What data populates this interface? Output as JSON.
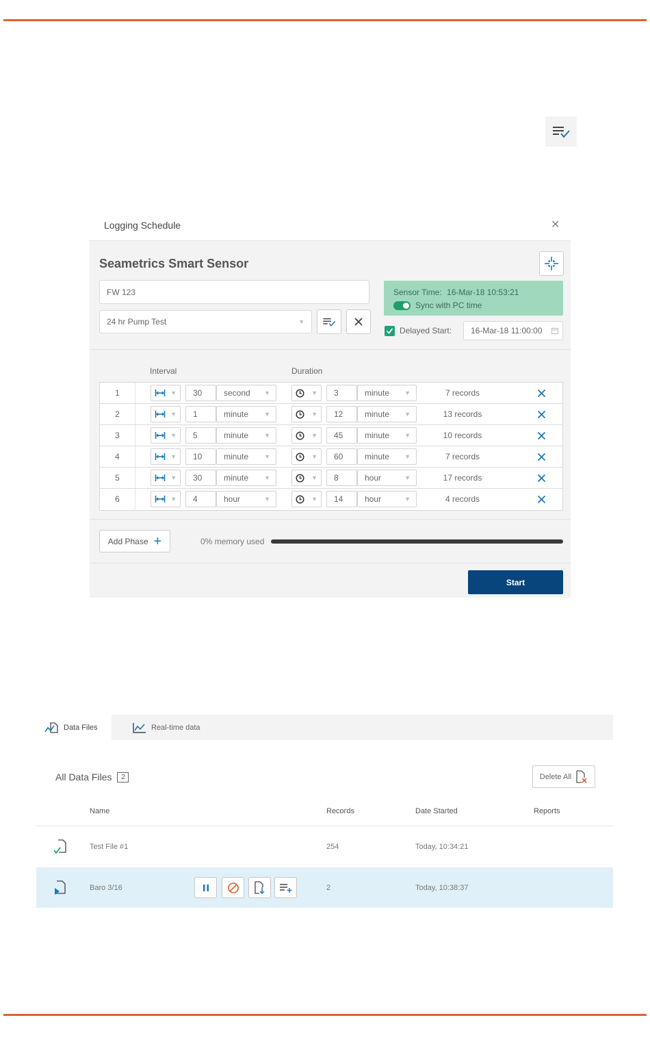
{
  "dialog": {
    "title": "Logging Schedule",
    "sensor_name": "Seametrics Smart Sensor",
    "name_input_value": "FW 123",
    "schedule_value": "24 hr Pump Test",
    "sensor_time_label": "Sensor Time:",
    "sensor_time_value": "16-Mar-18 10:53:21",
    "sync_label": "Sync with PC time",
    "sync_enabled": true,
    "delayed_start_label": "Delayed Start:",
    "delayed_start_checked": true,
    "delayed_start_value": "16-Mar-18 11:00:00",
    "interval_header": "Interval",
    "duration_header": "Duration",
    "phases": [
      {
        "num": "1",
        "interval": "30",
        "interval_unit": "second",
        "duration": "3",
        "duration_unit": "minute",
        "records": "7 records"
      },
      {
        "num": "2",
        "interval": "1",
        "interval_unit": "minute",
        "duration": "12",
        "duration_unit": "minute",
        "records": "13 records"
      },
      {
        "num": "3",
        "interval": "5",
        "interval_unit": "minute",
        "duration": "45",
        "duration_unit": "minute",
        "records": "10 records"
      },
      {
        "num": "4",
        "interval": "10",
        "interval_unit": "minute",
        "duration": "60",
        "duration_unit": "minute",
        "records": "7 records"
      },
      {
        "num": "5",
        "interval": "30",
        "interval_unit": "minute",
        "duration": "8",
        "duration_unit": "hour",
        "records": "17 records"
      },
      {
        "num": "6",
        "interval": "4",
        "interval_unit": "hour",
        "duration": "14",
        "duration_unit": "hour",
        "records": "4 records"
      }
    ],
    "add_phase_label": "Add Phase",
    "memory_label": "0% memory used",
    "memory_used_fraction": 0,
    "start_label": "Start"
  },
  "tabs": {
    "data_files": "Data Files",
    "realtime": "Real-time data"
  },
  "files": {
    "title": "All Data Files",
    "count": "2",
    "delete_all": "Delete All",
    "columns": {
      "name": "Name",
      "records": "Records",
      "date": "Date Started",
      "reports": "Reports"
    },
    "rows": [
      {
        "name": "Test File #1",
        "records": "254",
        "date": "Today, 10:34:21",
        "status": "complete"
      },
      {
        "name": "Baro 3/16",
        "records": "2",
        "date": "Today, 10:38:37",
        "status": "running"
      }
    ]
  },
  "colors": {
    "accent_orange": "#e0622a",
    "primary_blue": "#07457c",
    "icon_blue": "#1b79b8",
    "sync_green": "#1e9e6a",
    "sensor_panel": "#9fd8bd"
  }
}
